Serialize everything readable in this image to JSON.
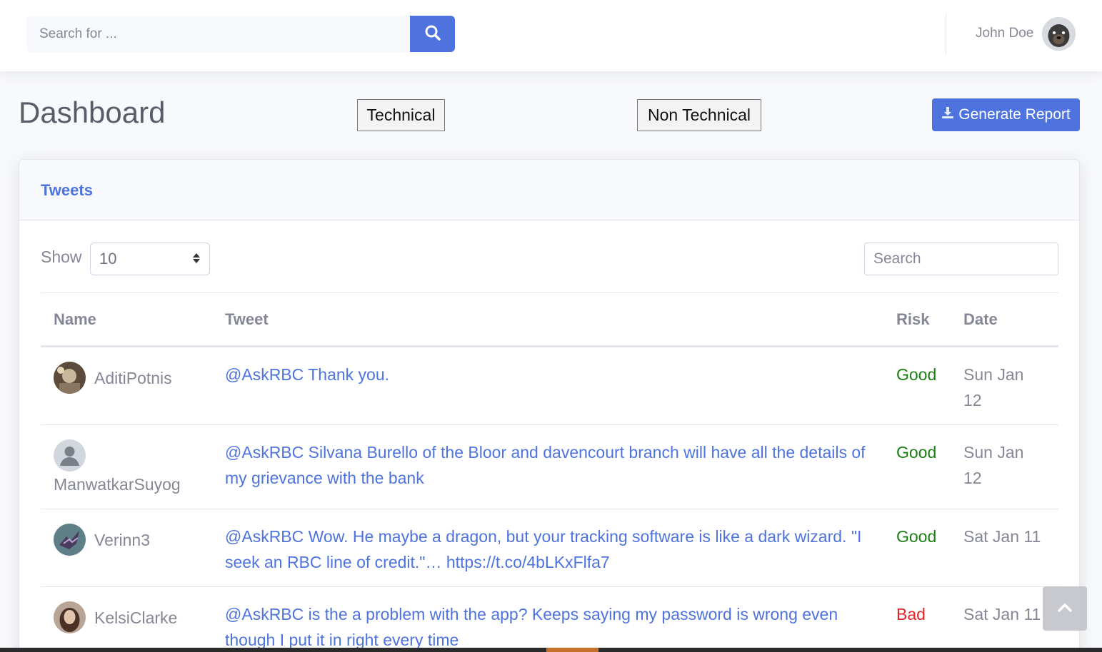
{
  "topbar": {
    "search_placeholder": "Search for ...",
    "user_name": "John Doe"
  },
  "header": {
    "title": "Dashboard",
    "technical_label": "Technical",
    "non_technical_label": "Non Technical",
    "generate_report_label": "Generate Report"
  },
  "card": {
    "title": "Tweets",
    "show_label": "Show",
    "show_value": "10",
    "search_placeholder": "Search"
  },
  "table": {
    "headers": {
      "name": "Name",
      "tweet": "Tweet",
      "risk": "Risk",
      "date": "Date"
    },
    "rows": [
      {
        "name": "AditiPotnis",
        "tweet": "@AskRBC Thank you.",
        "risk": "Good",
        "date": "Sun Jan 12"
      },
      {
        "name": "ManwatkarSuyog",
        "tweet": "@AskRBC Silvana Burello of the Bloor and davencourt branch will have all the details of my grievance with the bank",
        "risk": "Good",
        "date": "Sun Jan 12"
      },
      {
        "name": "Verinn3",
        "tweet": "@AskRBC Wow. He maybe a dragon, but your tracking software is like a dark wizard. \"I seek an RBC line of credit.\"… https://t.co/4bLKxFlfa7",
        "risk": "Good",
        "date": "Sat Jan 11"
      },
      {
        "name": "KelsiClarke",
        "tweet": "@AskRBC is the a problem with the app? Keeps saying my password is wrong even though I put it in right every time",
        "risk": "Bad",
        "date": "Sat Jan 11"
      }
    ]
  },
  "colors": {
    "primary": "#4e73df",
    "good": "#1a7f12",
    "bad": "#e02424"
  }
}
